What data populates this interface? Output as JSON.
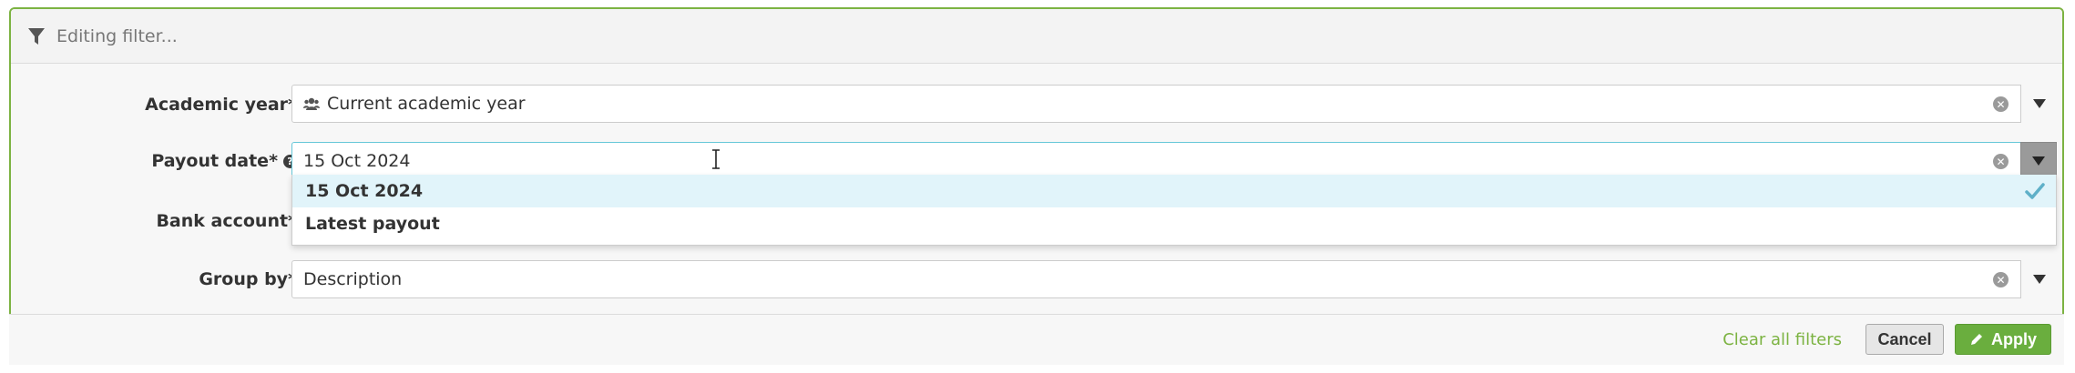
{
  "header": {
    "title": "Editing filter...",
    "icon": "filter-icon"
  },
  "fields": [
    {
      "label": "Academic year*",
      "value": "Current academic year",
      "icon": "users-icon"
    },
    {
      "label": "Payout date*",
      "value": "15 Oct 2024",
      "has_help": true,
      "help_icon": "question-circle-icon"
    },
    {
      "label": "Bank account*",
      "value": ""
    },
    {
      "label": "Group by*",
      "value": "Description"
    }
  ],
  "dropdown": {
    "options": [
      "15 Oct 2024",
      "Latest payout"
    ],
    "selected": "15 Oct 2024"
  },
  "footer": {
    "clear_all": "Clear all filters",
    "cancel": "Cancel",
    "apply": "Apply"
  },
  "colors": {
    "accent": "#7cb342",
    "apply_bg": "#6aae3e",
    "focus_border": "#66c7d8",
    "selected_option_bg": "#e1f4fa",
    "check": "#5fb0c8"
  }
}
